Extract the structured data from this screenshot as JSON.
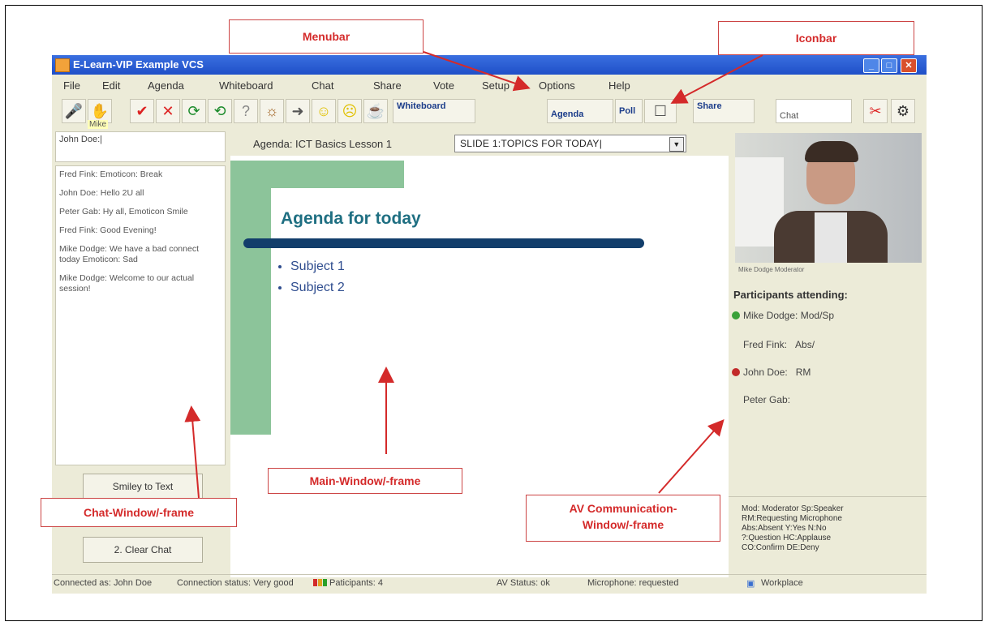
{
  "window": {
    "title": "E-Learn-VIP Example VCS"
  },
  "menu": [
    "File",
    "Edit",
    "Agenda",
    "Whiteboard",
    "Chat",
    "Share",
    "Vote",
    "Setup",
    "Options",
    "Help"
  ],
  "iconbar": {
    "tooltip": "Mike",
    "whiteboard_label": "Whiteboard",
    "agenda_label": "Agenda",
    "poll_label": "Poll",
    "share_label": "Share",
    "chat_field": "Chat"
  },
  "chat": {
    "input_value": "John Doe:|",
    "messages": [
      "Fred Fink: Emoticon: Break",
      "John Doe: Hello 2U all",
      "Peter Gab: Hy all, Emoticon Smile",
      "Fred Fink: Good Evening!",
      "Mike Dodge: We have a bad connect today Emoticon: Sad",
      "Mike Dodge: Welcome to our actual session!"
    ],
    "smiley_button": "Smiley to Text",
    "clear_button": "2. Clear Chat"
  },
  "agenda": {
    "label": "Agenda: ICT Basics Lesson 1",
    "selected_slide": "SLIDE 1:TOPICS FOR TODAY|"
  },
  "slide": {
    "title": "Agenda for today",
    "bullets": [
      "Subject 1",
      "Subject 2"
    ]
  },
  "av": {
    "video_caption": "Mike Dodge Moderator",
    "participants_title": "Participants attending:",
    "participants": [
      {
        "name": "Mike Dodge:",
        "status": "Mod/Sp",
        "mic": "#3aa13a"
      },
      {
        "name": "Fred Fink:",
        "status": "Abs/",
        "mic": ""
      },
      {
        "name": "John Doe:",
        "status": "RM",
        "mic": "#c22a2a"
      },
      {
        "name": "Peter Gab:",
        "status": "",
        "mic": ""
      }
    ],
    "legend": [
      "Mod: Moderator Sp:Speaker",
      "RM:Requesting Microphone",
      "Abs:Absent Y:Yes N:No",
      "?:Question HC:Applause",
      "CO:Confirm DE:Deny"
    ]
  },
  "status": {
    "connected": "Connected as: John Doe",
    "connection": "Connection status: Very good",
    "participants": "Paticipants: 4",
    "av": "AV Status: ok",
    "microphone": "Microphone: requested",
    "workplace": "Workplace",
    "signal_colors": [
      "#d22a2a",
      "#e0a020",
      "#2aa02a"
    ]
  },
  "annotations": {
    "menubar": "Menubar",
    "iconbar": "Iconbar",
    "chat_window": "Chat-Window/-frame",
    "main_window": "Main-Window/-frame",
    "av_window_line1": "AV Communication-",
    "av_window_line2": "Window/-frame"
  },
  "colors": {
    "annotation": "#d42a2a",
    "titlebar": "#2458d0",
    "slide_green": "#8cc49a",
    "slide_rule": "#123e6b"
  }
}
